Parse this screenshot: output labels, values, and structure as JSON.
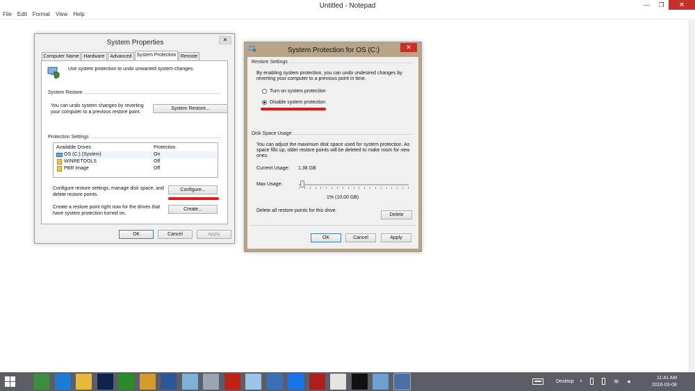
{
  "notepad": {
    "title": "Untitled - Notepad",
    "menu": [
      "File",
      "Edit",
      "Format",
      "View",
      "Help"
    ],
    "controls": {
      "minimize": "—",
      "maximize": "❐",
      "close": "✕"
    }
  },
  "system_properties": {
    "title": "System Properties",
    "close": "✕",
    "tabs": [
      "Computer Name",
      "Hardware",
      "Advanced",
      "System Protection",
      "Remote"
    ],
    "intro": "Use system protection to undo unwanted system changes.",
    "restore": {
      "heading": "System Restore",
      "text1": "You can undo system changes by reverting",
      "text2": "your computer to a previous restore point.",
      "button": "System Restore..."
    },
    "protection": {
      "heading": "Protection Settings",
      "columns": [
        "Available Drives",
        "Protection"
      ],
      "rows": [
        {
          "drive": "OS (C:) (System)",
          "protection": "On"
        },
        {
          "drive": "WINRETOOLS",
          "protection": "Off"
        },
        {
          "drive": "PBR Image",
          "protection": "Off"
        }
      ],
      "configure_text1": "Configure restore settings, manage disk space, and",
      "configure_text2": "delete restore points.",
      "configure_button": "Configure...",
      "create_text1": "Create a restore point right now for the drives that",
      "create_text2": "have system protection turned on.",
      "create_button": "Create..."
    },
    "buttons": {
      "ok": "OK",
      "cancel": "Cancel",
      "apply": "Apply"
    }
  },
  "system_protection": {
    "title": "System Protection for OS (C:)",
    "close": "✕",
    "restore_settings": {
      "heading": "Restore Settings",
      "text1": "By enabling system protection, you can undo undesired changes by",
      "text2": "reverting your computer to a previous point in time.",
      "option_on": "Turn on system protection",
      "option_off": "Disable system protection",
      "selected": "Disable system protection"
    },
    "disk_space": {
      "heading": "Disk Space Usage",
      "text1": "You can adjust the maximum disk space used for system protection. As",
      "text2": "space fills up, older restore points will be deleted to make room for new",
      "text3": "ones.",
      "current_label": "Current Usage:",
      "current_value": "1.38 GB",
      "max_label": "Max Usage:",
      "max_fraction": 0.01,
      "max_value_text": "1% (10.00 GB)",
      "delete_text": "Delete all restore points for this drive.",
      "delete_button": "Delete"
    },
    "buttons": {
      "ok": "OK",
      "cancel": "Cancel",
      "apply": "Apply"
    }
  },
  "taskbar": {
    "desktop_label": "Desktop",
    "time": "11:41 AM",
    "date": "2016-03-08",
    "apps": [
      {
        "name": "chrome-icon",
        "color": "#3d8c40"
      },
      {
        "name": "internet-explorer-icon",
        "color": "#1e7bd6"
      },
      {
        "name": "file-explorer-icon",
        "color": "#e8b83a"
      },
      {
        "name": "photoshop-icon",
        "color": "#10214a"
      },
      {
        "name": "dreamweaver-icon",
        "color": "#2c8a2c"
      },
      {
        "name": "outlook-icon",
        "color": "#d29b2c"
      },
      {
        "name": "word-icon",
        "color": "#2b579a"
      },
      {
        "name": "app-blue-icon",
        "color": "#7fb0d6"
      },
      {
        "name": "calculator-icon",
        "color": "#9aa4b2"
      },
      {
        "name": "filezilla-icon",
        "color": "#bf2116"
      },
      {
        "name": "messenger-icon",
        "color": "#9bc4e6"
      },
      {
        "name": "network-icon",
        "color": "#3d6fb4"
      },
      {
        "name": "teamviewer-icon",
        "color": "#1a73e8"
      },
      {
        "name": "vnc-icon",
        "color": "#b01d1d"
      },
      {
        "name": "tiles-icon",
        "color": "#e4e4e4"
      },
      {
        "name": "cmd-icon",
        "color": "#111111"
      },
      {
        "name": "remote-desktop-icon",
        "color": "#6f9fcf"
      },
      {
        "name": "system-icon",
        "color": "#4a6fa3"
      }
    ]
  },
  "colors": {
    "close_red": "#c7302a",
    "annotation_red": "#e31818",
    "taskbar": "#5d5d65"
  }
}
